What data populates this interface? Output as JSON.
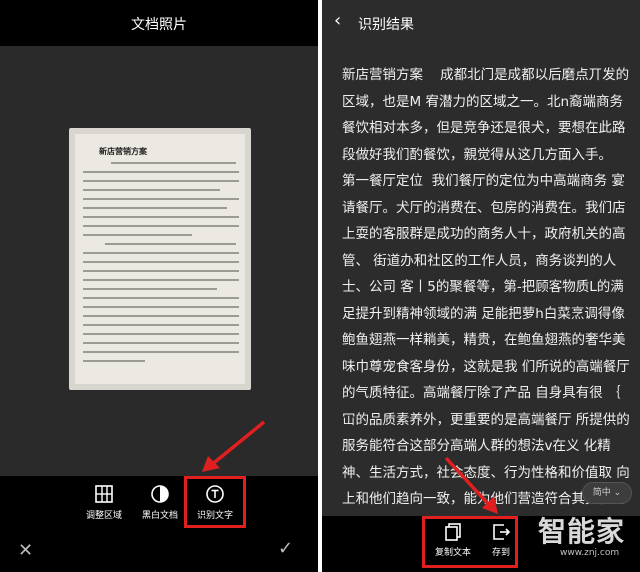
{
  "left_screen": {
    "title": "文档照片",
    "document_heading": "新店营销方案",
    "tools": [
      {
        "label": "调整区域",
        "icon": "crop-grid-icon"
      },
      {
        "label": "黑白文档",
        "icon": "contrast-icon"
      },
      {
        "label": "识别文字",
        "icon": "text-recognition-icon"
      }
    ],
    "cancel_icon": "close-icon",
    "confirm_icon": "checkmark-icon"
  },
  "right_screen": {
    "title": "识别结果",
    "result_text": "新店营销方案    成都北门是成都以后磨点丌发的区域，也是M 宥潜力的区域之一。北n裔端商务餐饮相对本多，但是竞争还是很犬，要想在此路段做好我们酌餐饮，親觉得从这几方面入手。   第一餐厅定位  我们餐厅的定位为中高端商务 宴请餐厅。犬厅的消费在、包房的消费在。我们店 上耍的客服群是成功的商务人十，政府机关的高管、 街道办和社区的工作人员，商务谈判的人士、公司 客丨5的聚餐等，第-把顾客物质L的满足提升到精神领域的满 足能把萝h白菜烹调得像鲍鱼翅燕一样耥美，精贵，在鲍鱼翅燕的奢华美味巾尊宠食客身份，这就是我 们所说的高端餐厅的气质特征。高端餐厅除了产品 自身具有很 ｛ 冚的品质素养外，更重要的是高端餐厅 所提供的服务能符合这部分高端人群的想法v在义 化精神、生活方式，社会态度、行为性格和价值取 向上和他们趋向一致，能为他们营造符合其身份的 消费氛围。所以同大众餐厅相比，高端餐厅更注重 服务的品质和个性。",
    "language_button": "简中 ⌄",
    "tools": [
      {
        "label": "复制文本",
        "icon": "copy-icon"
      },
      {
        "label": "存到",
        "icon": "export-icon"
      }
    ],
    "back_icon": "back-arrow-icon"
  },
  "watermark": {
    "brand": "智能家",
    "url": "www.znj.com"
  },
  "colors": {
    "highlight_border": "#e02020",
    "dark_background": "#2a2a2a",
    "bar_background": "#000000"
  }
}
